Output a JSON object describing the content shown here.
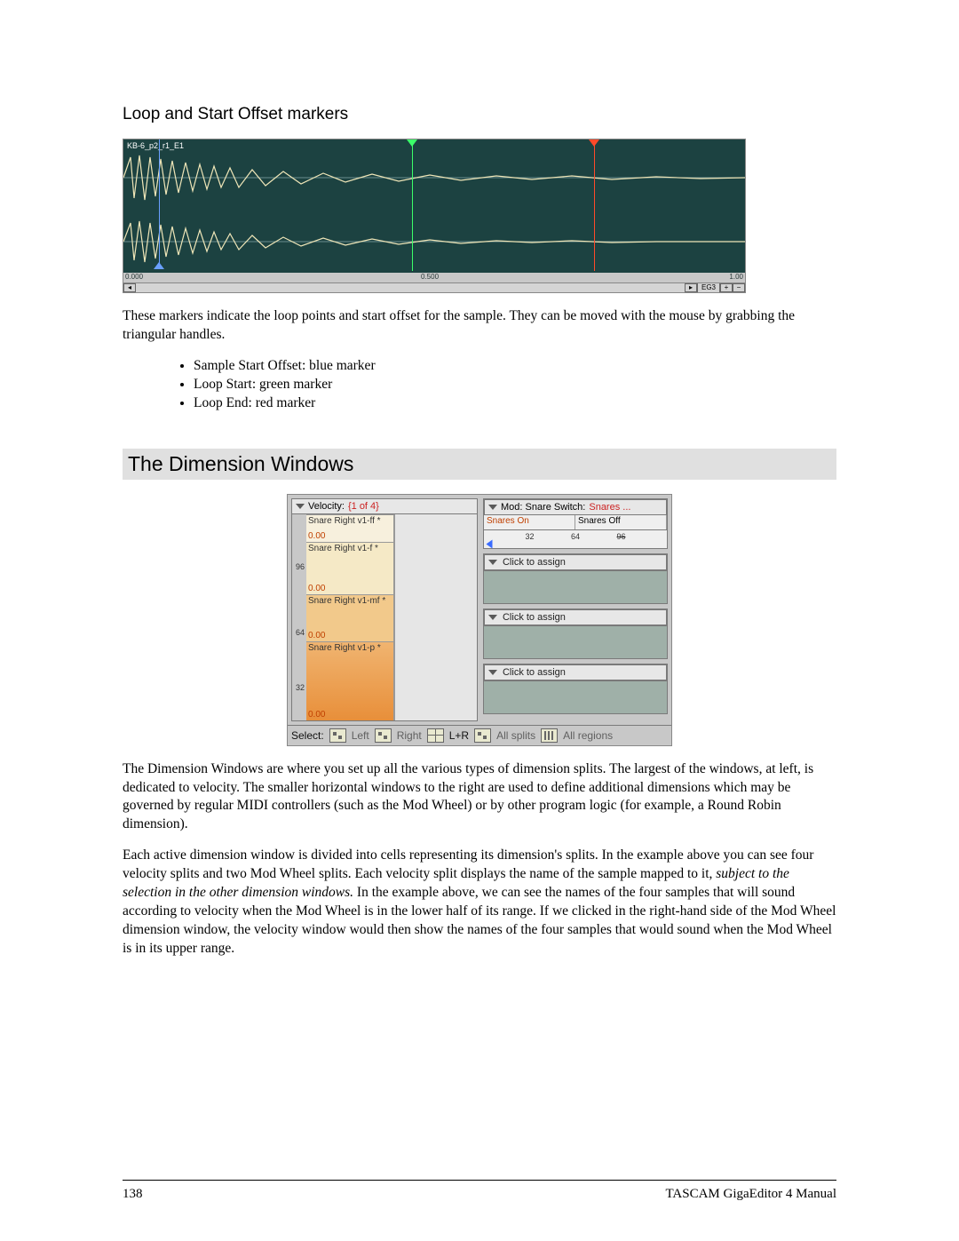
{
  "section1": {
    "heading": "Loop and Start Offset markers",
    "paragraph": "These markers indicate the loop points and start offset for the sample.  They can be moved with the mouse by grabbing the triangular handles.",
    "bullets": [
      "Sample Start Offset: blue marker",
      "Loop Start: green marker",
      "Loop End: red marker"
    ]
  },
  "waveform": {
    "sample_label": "KB-6_p2_r1_E1",
    "ruler": {
      "t0": "0.000",
      "t1": "0.500",
      "t2": "1.00"
    },
    "scroll_right_label": "EG3"
  },
  "section2": {
    "heading": "The Dimension Windows",
    "paragraph1": "The Dimension Windows are where you set up all the various types of dimension splits.  The largest of the windows, at left, is dedicated to velocity.  The smaller horizontal windows to the right are used to define additional dimensions which may be governed by regular MIDI controllers (such as the Mod Wheel) or by other program logic (for example, a Round Robin dimension).",
    "paragraph2_a": "Each active dimension window is divided into cells representing its dimension's splits.  In the example above you can see four velocity splits and two Mod Wheel splits.  Each velocity split displays the name of the sample mapped to it, ",
    "paragraph2_em": "subject to the selection in the other dimension windows.",
    "paragraph2_b": "  In the example above, we can see the names of the four samples that will sound according to velocity when the Mod Wheel is in the lower half of its range.  If we clicked in the right-hand side of the Mod Wheel dimension window, the velocity window would then show the names of the four samples that would sound when the Mod Wheel is in its upper range."
  },
  "dim": {
    "velocity": {
      "header_prefix": "Velocity: ",
      "header_count": "{1 of 4}",
      "axis": {
        "v96": "96",
        "v64": "64",
        "v32": "32"
      },
      "cells": [
        {
          "label": "Snare Right v1-ff *",
          "sub": "0.00"
        },
        {
          "label": "Snare Right v1-f *",
          "sub": "0.00"
        },
        {
          "label": "Snare Right v1-mf *",
          "sub": "0.00"
        },
        {
          "label": "Snare Right v1-p *",
          "sub": "0.00"
        }
      ]
    },
    "mod": {
      "header_prefix": "Mod: Snare Switch: ",
      "header_sel": "Snares ...",
      "cell_on": "Snares On",
      "cell_off": "Snares Off",
      "ticks": {
        "t32": "32",
        "t64": "64",
        "t96": "96"
      },
      "click_to_assign": "Click to assign"
    },
    "footer": {
      "select": "Select:",
      "left": "Left",
      "right": "Right",
      "lr": "L+R",
      "all_splits": "All splits",
      "all_regions": "All regions"
    }
  },
  "footer": {
    "page": "138",
    "manual": "TASCAM GigaEditor 4 Manual"
  }
}
